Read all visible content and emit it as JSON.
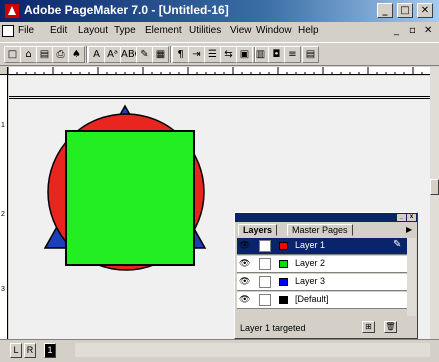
{
  "titlebar": {
    "title": "Adobe PageMaker 7.0 - [Untitled-16]",
    "minimize_glyph": "_",
    "maximize_glyph": "□",
    "close_glyph": "✕"
  },
  "menubar": {
    "items": [
      "File",
      "Edit",
      "Layout",
      "Type",
      "Element",
      "Utilities",
      "View",
      "Window",
      "Help"
    ],
    "doc_min": "_",
    "doc_restore": "▫",
    "doc_close": "✕"
  },
  "toolbar": {
    "buttons": [
      {
        "name": "new-icon",
        "glyph": "□"
      },
      {
        "name": "open-icon",
        "glyph": "⌂"
      },
      {
        "name": "save-icon",
        "glyph": "▤"
      },
      {
        "name": "print-icon",
        "glyph": "⎙"
      },
      {
        "name": "find-icon",
        "glyph": "♠"
      },
      {
        "name": "character-style-icon",
        "glyph": "A"
      },
      {
        "name": "font-size-icon",
        "glyph": "Aᵃ"
      },
      {
        "name": "spell-check-icon",
        "glyph": "ABC"
      },
      {
        "name": "place-icon",
        "glyph": "✎"
      },
      {
        "name": "image-icon",
        "glyph": "▦"
      },
      {
        "name": "paragraph-icon",
        "glyph": "¶"
      },
      {
        "name": "indent-icon",
        "glyph": "⇥"
      },
      {
        "name": "list-icon",
        "glyph": "☰"
      },
      {
        "name": "text-wrap-icon",
        "glyph": "⇆"
      },
      {
        "name": "frame-icon",
        "glyph": "▣"
      },
      {
        "name": "columns-icon",
        "glyph": "▥"
      },
      {
        "name": "camera-icon",
        "glyph": "◘"
      },
      {
        "name": "layout-icon",
        "glyph": "≡"
      },
      {
        "name": "more-icon",
        "glyph": "▤"
      }
    ]
  },
  "rulers": {
    "vertical_labels": [
      "1",
      "2",
      "3"
    ]
  },
  "document": {
    "shapes": {
      "triangle_color": "#1a3fbf",
      "circle_color": "#e8261f",
      "square_color": "#22ee22"
    }
  },
  "pages": {
    "left": "L",
    "right": "R",
    "current": "1"
  },
  "layers_palette": {
    "tabs": [
      "Layers",
      "Master Pages"
    ],
    "active_tab": "Layers",
    "layers": [
      {
        "name": "Layer 1",
        "color": "#ff0000",
        "selected": true
      },
      {
        "name": "Layer 2",
        "color": "#00e000",
        "selected": false
      },
      {
        "name": "Layer 3",
        "color": "#0000ff",
        "selected": false
      },
      {
        "name": "[Default]",
        "color": "#000000",
        "selected": false
      }
    ],
    "status": "Layer 1 targeted",
    "eye_glyph": "👁",
    "pen_glyph": "✎",
    "new_layer_glyph": "⊞",
    "delete_glyph": "🗑"
  }
}
